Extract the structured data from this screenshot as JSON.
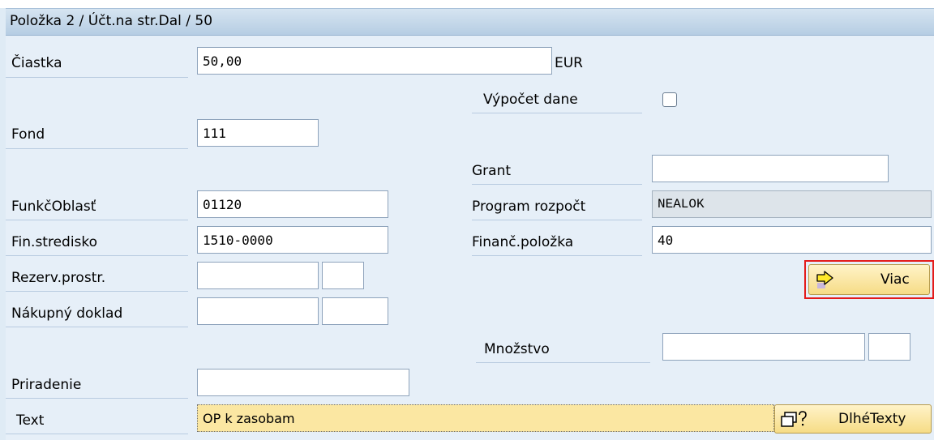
{
  "header": {
    "title": "Položka 2 / Účt.na str.Dal / 50"
  },
  "fields": {
    "ciastka": {
      "label": "Čiastka",
      "value": "50,00",
      "currency": "EUR"
    },
    "vypocet_dane": {
      "label": "Výpočet dane",
      "checked": false
    },
    "fond": {
      "label": "Fond",
      "value": "111"
    },
    "grant": {
      "label": "Grant",
      "value": ""
    },
    "funkc_oblast": {
      "label": "FunkčOblasť",
      "value": "01120"
    },
    "program_rozpoct": {
      "label": "Program rozpočt",
      "value": "NEALOK"
    },
    "fin_stredisko": {
      "label": "Fin.stredisko",
      "value": "1510-0000"
    },
    "financ_polozka": {
      "label": "Finanč.položka",
      "value": "40"
    },
    "rezerv_prostr": {
      "label": "Rezerv.prostr.",
      "value": "",
      "value2": ""
    },
    "nakupny_doklad": {
      "label": "Nákupný doklad",
      "value": "",
      "value2": ""
    },
    "mnozstvo": {
      "label": "Množstvo",
      "value": "",
      "unit": ""
    },
    "priradenie": {
      "label": "Priradenie",
      "value": ""
    },
    "text": {
      "label": "Text",
      "value": "OP k zasobam"
    }
  },
  "buttons": {
    "viac": {
      "label": "Viac",
      "icon": "arrow-right-icon"
    },
    "dlhe_texty": {
      "label": "DlhéTexty",
      "icon": "long-text-icon"
    }
  },
  "colors": {
    "highlight_border": "#e41b1b",
    "button_yellow": "#f6dc86",
    "panel": "#e6eff8"
  }
}
